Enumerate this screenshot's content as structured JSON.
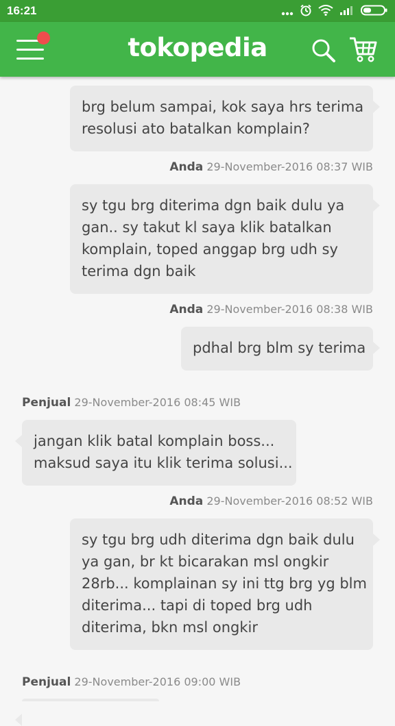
{
  "status_bar": {
    "time": "16:21",
    "icons": [
      "dots-icon",
      "alarm-icon",
      "wifi-icon",
      "signal-icon",
      "battery-icon"
    ]
  },
  "app_bar": {
    "logo": "tokopedia",
    "colors": {
      "primary": "#42b549",
      "status": "#3a9e34",
      "badge": "#ef4d4d"
    }
  },
  "messages": [
    {
      "side": "right",
      "lines": [
        "brg belum sampai, kok saya hrs terima",
        "resolusi ato batalkan komplain?"
      ]
    },
    {
      "side": "right",
      "sender": "Anda",
      "timestamp": "29-November-2016 08:37 WIB",
      "lines": [
        "sy tgu brg diterima dgn baik dulu ya",
        "gan.. sy takut kl saya klik batalkan",
        "komplain, toped anggap brg udh sy",
        "terima dgn baik"
      ]
    },
    {
      "side": "right",
      "sender": "Anda",
      "timestamp": "29-November-2016 08:38 WIB",
      "lines": [
        "pdhal brg blm sy terima"
      ]
    },
    {
      "side": "left",
      "sender": "Penjual",
      "timestamp": "29-November-2016 08:45 WIB",
      "lines": [
        "jangan klik batal komplain boss...",
        "maksud saya itu klik terima solusi..."
      ]
    },
    {
      "side": "right",
      "sender": "Anda",
      "timestamp": "29-November-2016 08:52 WIB",
      "lines": [
        "sy tgu brg udh diterima dgn baik dulu",
        "ya gan, br kt bicarakan msl ongkir",
        "28rb... komplainan sy ini ttg brg yg blm",
        "diterima... tapi di toped brg udh",
        "diterima, bkn msl ongkir"
      ]
    },
    {
      "side": "left",
      "sender": "Penjual",
      "timestamp": "29-November-2016 09:00 WIB",
      "lines": []
    }
  ]
}
